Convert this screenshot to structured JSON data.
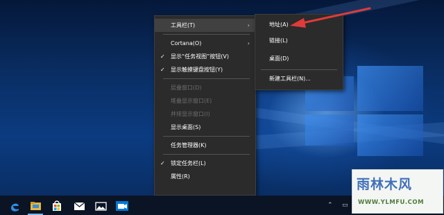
{
  "context_menu": {
    "items": [
      {
        "label": "工具栏(T)"
      },
      {
        "label": "Cortana(O)"
      },
      {
        "label": "显示“任务视图”按钮(V)"
      },
      {
        "label": "显示触摸键盘按钮(Y)"
      },
      {
        "label": "层叠窗口(D)"
      },
      {
        "label": "堆叠显示窗口(E)"
      },
      {
        "label": "并排显示窗口(I)"
      },
      {
        "label": "显示桌面(S)"
      },
      {
        "label": "任务管理器(K)"
      },
      {
        "label": "锁定任务栏(L)"
      },
      {
        "label": "属性(R)"
      }
    ]
  },
  "submenu": {
    "items": [
      {
        "label": "地址(A)"
      },
      {
        "label": "链接(L)"
      },
      {
        "label": "桌面(D)"
      },
      {
        "label": "新建工具栏(N)..."
      }
    ]
  },
  "glyphs": {
    "check": "✓",
    "arrow": "›"
  },
  "colors": {
    "menu_bg": "#2b2b2b",
    "menu_highlight": "#414141",
    "annotation_arrow": "#e03b3b",
    "taskbar_bg": "#0b1424",
    "accent": "#0078d7"
  },
  "taskbar": {
    "icons": [
      "edge-icon",
      "file-explorer-icon",
      "store-icon",
      "mail-icon",
      "photos-icon",
      "camera-icon"
    ],
    "tray_icons": [
      "chevron-up-icon",
      "network-icon",
      "volume-icon"
    ]
  },
  "watermark": {
    "title": "雨林木风",
    "url": "WWW.YLMFU.COM"
  }
}
